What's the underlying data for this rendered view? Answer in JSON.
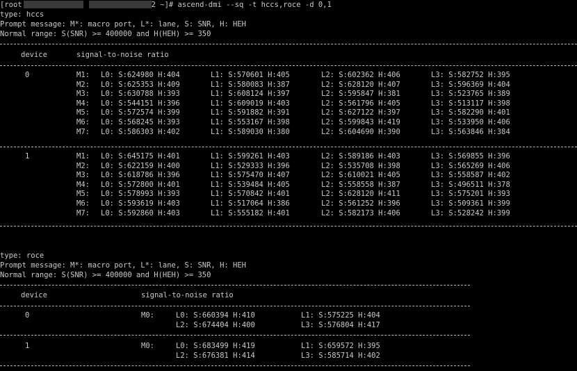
{
  "prompt": {
    "user": "[root",
    "host_tail": "2 ~]#",
    "command": "ascend-dmi --sq -t hccs,roce -d 0,1"
  },
  "sections": [
    {
      "type_line": "type: hccs",
      "prompt_message": "Prompt message: M*: macro port, L*: lane, S: SNR, H: HEH",
      "normal_range": "Normal range: S(SNR) >= 400000 and H(HEH) >= 350",
      "col_device": "device",
      "col_snr": "signal-to-noise ratio",
      "devices": [
        {
          "id": "0",
          "rows": [
            {
              "port": "M1:",
              "cells": [
                "L0: S:624980 H:404",
                "L1: S:570601 H:405",
                "L2: S:602362 H:406",
                "L3: S:582752 H:395"
              ]
            },
            {
              "port": "M2:",
              "cells": [
                "L0: S:625353 H:409",
                "L1: S:580083 H:387",
                "L2: S:628120 H:407",
                "L3: S:596369 H:404"
              ]
            },
            {
              "port": "M3:",
              "cells": [
                "L0: S:630788 H:393",
                "L1: S:608124 H:397",
                "L2: S:595847 H:381",
                "L3: S:523765 H:389"
              ]
            },
            {
              "port": "M4:",
              "cells": [
                "L0: S:544151 H:396",
                "L1: S:609019 H:403",
                "L2: S:561796 H:405",
                "L3: S:513117 H:398"
              ]
            },
            {
              "port": "M5:",
              "cells": [
                "L0: S:572574 H:399",
                "L1: S:591882 H:391",
                "L2: S:627122 H:397",
                "L3: S:582290 H:401"
              ]
            },
            {
              "port": "M6:",
              "cells": [
                "L0: S:568245 H:393",
                "L1: S:553167 H:398",
                "L2: S:599843 H:419",
                "L3: S:533950 H:406"
              ]
            },
            {
              "port": "M7:",
              "cells": [
                "L0: S:586303 H:402",
                "L1: S:589030 H:380",
                "L2: S:604690 H:390",
                "L3: S:563846 H:384"
              ]
            }
          ]
        },
        {
          "id": "1",
          "rows": [
            {
              "port": "M1:",
              "cells": [
                "L0: S:645175 H:401",
                "L1: S:599261 H:403",
                "L2: S:589186 H:403",
                "L3: S:569855 H:396"
              ]
            },
            {
              "port": "M2:",
              "cells": [
                "L0: S:622159 H:400",
                "L1: S:529333 H:396",
                "L2: S:535708 H:398",
                "L3: S:565269 H:406"
              ]
            },
            {
              "port": "M3:",
              "cells": [
                "L0: S:618786 H:396",
                "L1: S:575470 H:407",
                "L2: S:610021 H:405",
                "L3: S:558587 H:402"
              ]
            },
            {
              "port": "M4:",
              "cells": [
                "L0: S:572800 H:401",
                "L1: S:539484 H:405",
                "L2: S:558558 H:387",
                "L3: S:496511 H:378"
              ]
            },
            {
              "port": "M5:",
              "cells": [
                "L0: S:578993 H:393",
                "L1: S:570842 H:401",
                "L2: S:628120 H:411",
                "L3: S:575201 H:393"
              ]
            },
            {
              "port": "M6:",
              "cells": [
                "L0: S:593619 H:403",
                "L1: S:517064 H:386",
                "L2: S:561252 H:396",
                "L3: S:509361 H:399"
              ]
            },
            {
              "port": "M7:",
              "cells": [
                "L0: S:592860 H:403",
                "L1: S:555182 H:401",
                "L2: S:582173 H:406",
                "L3: S:528242 H:399"
              ]
            }
          ]
        }
      ]
    },
    {
      "type_line": "type: roce",
      "prompt_message": "Prompt message: M*: macro port, L*: lane, S: SNR, H: HEH",
      "normal_range": "Normal range: S(SNR) >= 400000 and H(HEH) >= 350",
      "col_device": "device",
      "col_snr": "signal-to-noise ratio",
      "devices": [
        {
          "id": "0",
          "port": "M0:",
          "rows": [
            [
              "L0: S:660394 H:410",
              "L1: S:575225 H:404"
            ],
            [
              "L2: S:674404 H:400",
              "L3: S:576804 H:417"
            ]
          ]
        },
        {
          "id": "1",
          "port": "M0:",
          "rows": [
            [
              "L0: S:683499 H:419",
              "L1: S:659572 H:395"
            ],
            [
              "L2: S:676381 H:414",
              "L3: S:585714 H:402"
            ]
          ]
        }
      ]
    }
  ],
  "colors": {
    "background": "#000000",
    "text": "#c9c9c9",
    "redaction": "#3a3a3a"
  }
}
